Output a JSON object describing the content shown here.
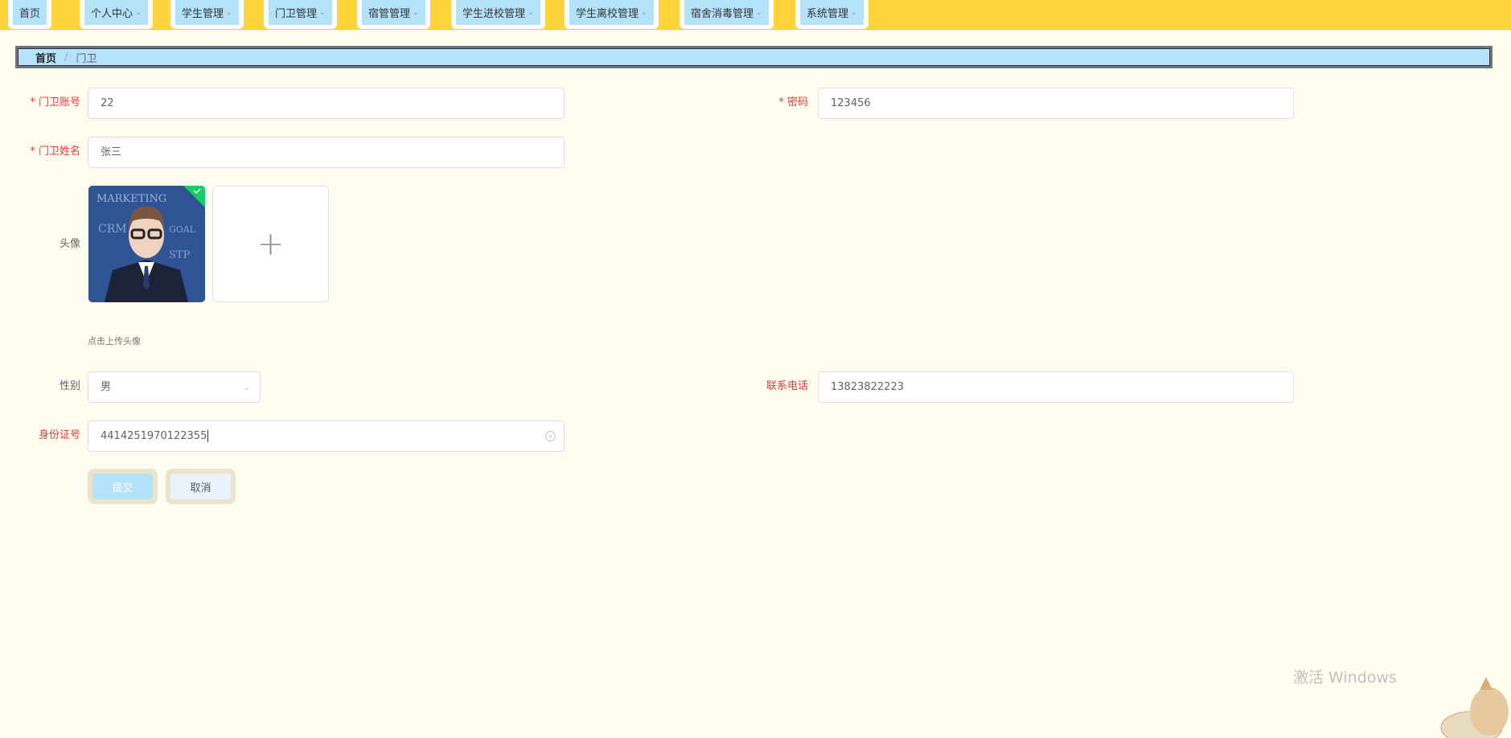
{
  "nav": {
    "items": [
      {
        "label": "首页",
        "dropdown": false
      },
      {
        "label": "个人中心",
        "dropdown": true
      },
      {
        "label": "学生管理",
        "dropdown": true
      },
      {
        "label": "门卫管理",
        "dropdown": true
      },
      {
        "label": "宿管管理",
        "dropdown": true
      },
      {
        "label": "学生进校管理",
        "dropdown": true
      },
      {
        "label": "学生离校管理",
        "dropdown": true
      },
      {
        "label": "宿舍消毒管理",
        "dropdown": true
      },
      {
        "label": "系统管理",
        "dropdown": true
      }
    ]
  },
  "breadcrumb": {
    "home": "首页",
    "sep": "/",
    "current": "门卫"
  },
  "form": {
    "account": {
      "label": "门卫账号",
      "value": "22"
    },
    "password": {
      "label": "密码",
      "value": "123456"
    },
    "name": {
      "label": "门卫姓名",
      "value": "张三"
    },
    "avatar": {
      "label": "头像",
      "hint": "点击上传头像",
      "image_text": "MARKETING"
    },
    "gender": {
      "label": "性别",
      "value": "男"
    },
    "phone": {
      "label": "联系电话",
      "value": "13823822223"
    },
    "idcard": {
      "label": "身份证号",
      "value": "4414251970122355"
    },
    "submit": "提交",
    "cancel": "取消"
  },
  "watermark": "激活 Windows",
  "colors": {
    "nav": "#ffd43b",
    "accent": "#b5e2fb",
    "required": "#e4393c",
    "bg": "#fffdf0"
  }
}
